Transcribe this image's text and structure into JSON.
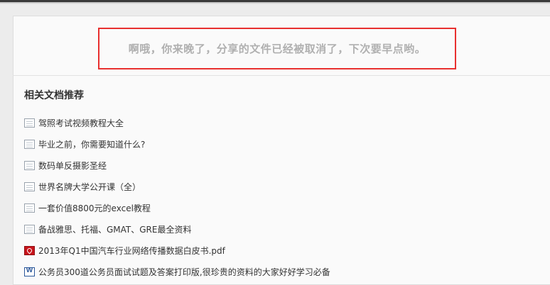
{
  "notice": {
    "message": "啊哦，你来晚了，分享的文件已经被取消了，下次要早点哟。"
  },
  "related": {
    "title": "相关文档推荐",
    "items": [
      {
        "label": "驾照考试视频教程大全",
        "icon": "generic-file-icon"
      },
      {
        "label": "毕业之前，你需要知道什么?",
        "icon": "generic-file-icon"
      },
      {
        "label": "数码单反摄影圣经",
        "icon": "generic-file-icon"
      },
      {
        "label": "世界名牌大学公开课（全）",
        "icon": "generic-file-icon"
      },
      {
        "label": "一套价值8800元的excel教程",
        "icon": "generic-file-icon"
      },
      {
        "label": "备战雅思、托福、GMAT、GRE最全资料",
        "icon": "generic-file-icon"
      },
      {
        "label": "2013年Q1中国汽车行业网络传播数据白皮书.pdf",
        "icon": "pdf-file-icon"
      },
      {
        "label": "公务员300道公务员面试试题及答案打印版,很珍贵的资料的大家好好学习必备",
        "icon": "word-file-icon"
      }
    ]
  },
  "colors": {
    "notice_border": "#e8302f",
    "notice_text": "#b0b0b0",
    "pdf_icon": "#c8141b",
    "word_icon": "#2b579a"
  }
}
